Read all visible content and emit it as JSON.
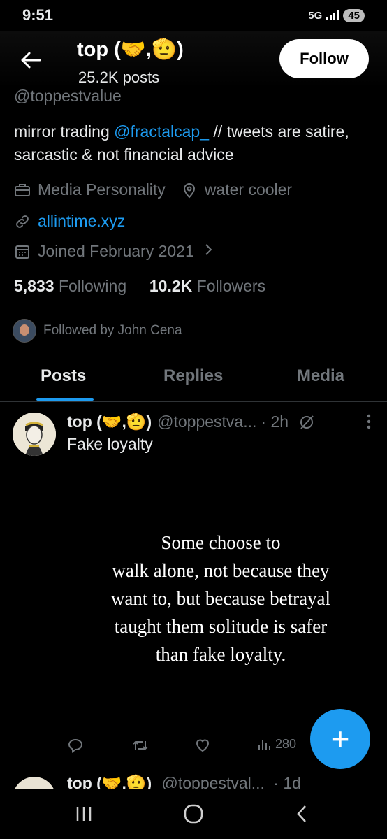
{
  "status": {
    "time": "9:51",
    "network": "5G",
    "battery": "45"
  },
  "header": {
    "name": "top (🤝,🫡)",
    "posts": "25.2K posts",
    "follow_label": "Follow"
  },
  "profile": {
    "handle": "@toppestvalue",
    "bio_before": "mirror trading ",
    "bio_link": "@fractalcap_",
    "bio_after": " // tweets are satire, sarcastic & not financial advice",
    "category": "Media Personality",
    "location": "water cooler",
    "website": "allintime.xyz",
    "joined": "Joined February 2021",
    "following_count": "5,833",
    "following_label": "Following",
    "followers_count": "10.2K",
    "followers_label": "Followers",
    "followed_by": "Followed by John Cena"
  },
  "tabs": [
    {
      "label": "Posts",
      "active": true
    },
    {
      "label": "Replies",
      "active": false
    },
    {
      "label": "Media",
      "active": false
    }
  ],
  "post": {
    "author": "top (🤝,🫡)",
    "handle": "@toppestva...",
    "time": "· 2h",
    "text": "Fake loyalty",
    "image_text": [
      "Some choose to",
      "walk alone, not because they",
      "want to, but because betrayal",
      "taught them solitude is safer",
      "than fake loyalty."
    ],
    "views": "280"
  },
  "next_post": {
    "author": "top (🤝,🫡)",
    "handle": "@toppestval...",
    "time": "· 1d"
  },
  "fab_label": "+",
  "colors": {
    "accent": "#1d9bf0",
    "background": "#000000",
    "secondary_text": "#71767b"
  }
}
